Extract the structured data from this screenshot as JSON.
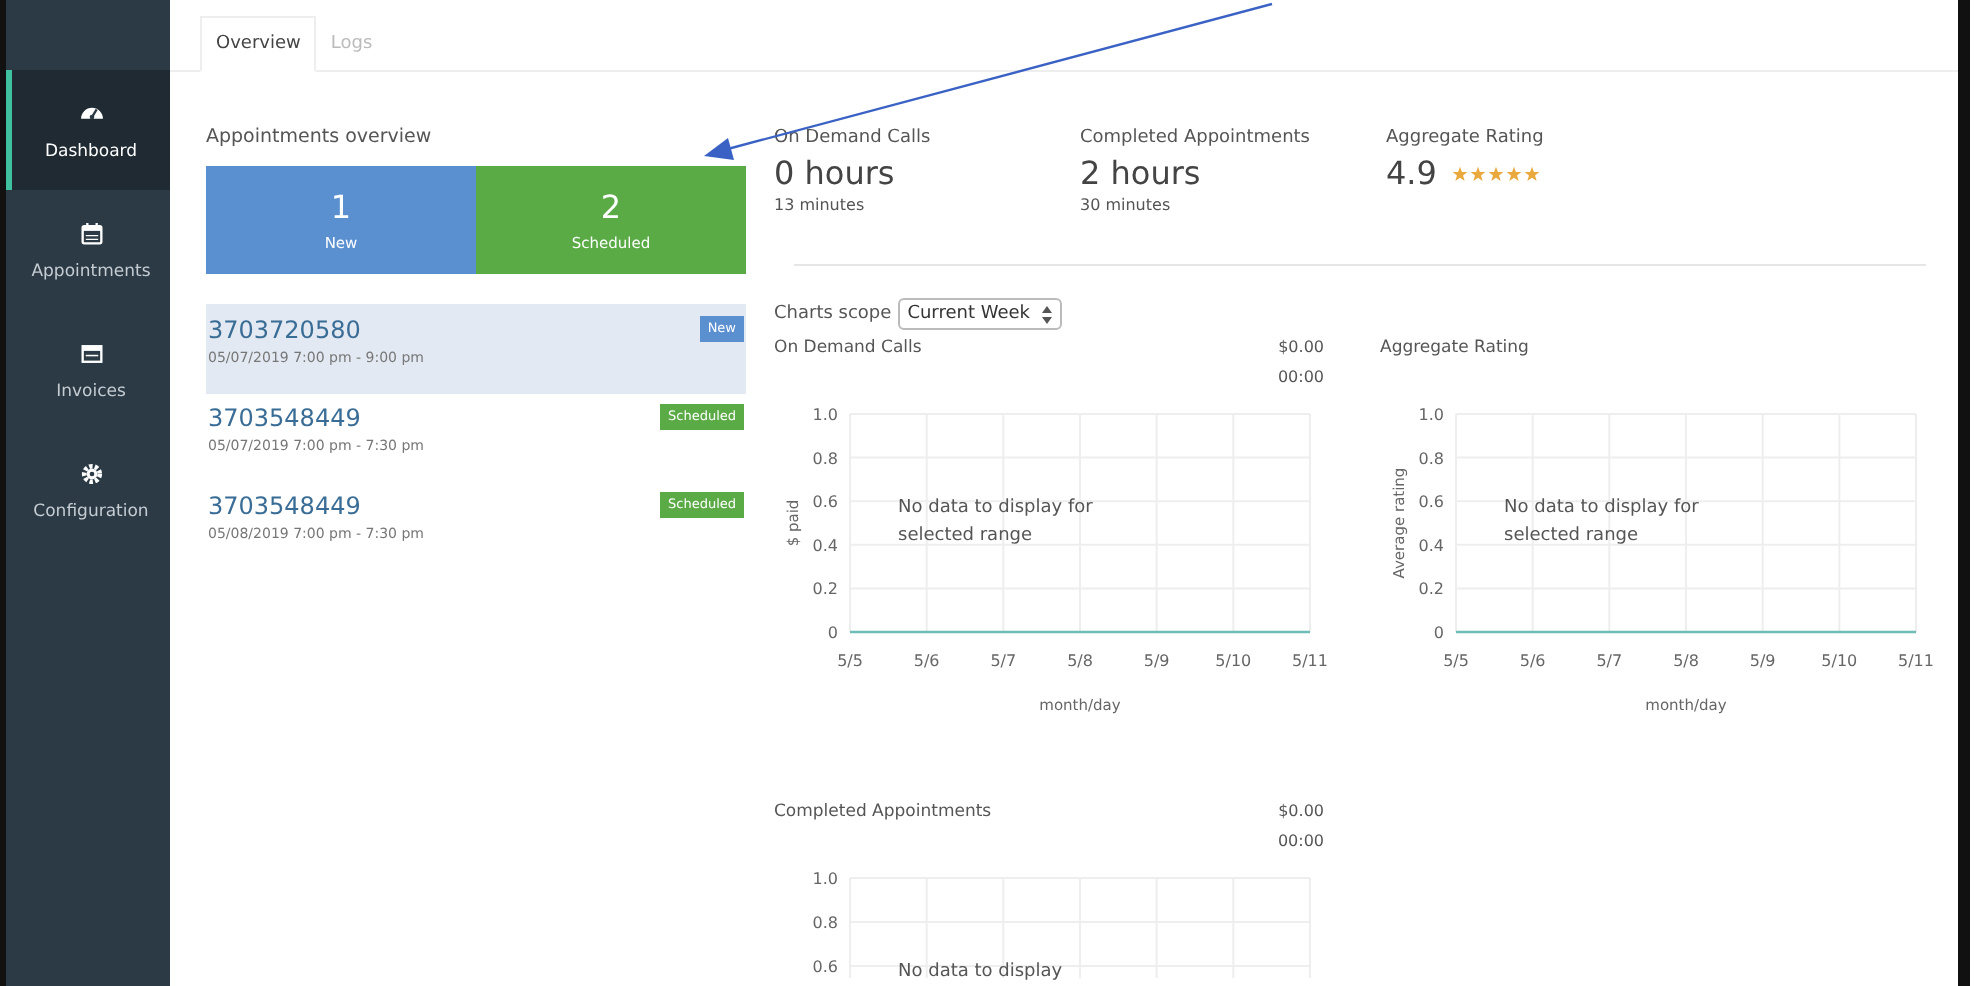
{
  "sidebar": {
    "items": [
      {
        "label": "Dashboard",
        "selected": true
      },
      {
        "label": "Appointments",
        "selected": false
      },
      {
        "label": "Invoices",
        "selected": false
      },
      {
        "label": "Configuration",
        "selected": false
      }
    ]
  },
  "tabs": [
    {
      "label": "Overview",
      "selected": true
    },
    {
      "label": "Logs",
      "selected": false
    }
  ],
  "appointments_overview": {
    "title": "Appointments overview",
    "tiles": [
      {
        "count": "1",
        "label": "New",
        "kind": "new"
      },
      {
        "count": "2",
        "label": "Scheduled",
        "kind": "scheduled"
      }
    ],
    "appointments": [
      {
        "number": "3703720580",
        "time": "05/07/2019 7:00 pm - 9:00 pm",
        "badge": "New",
        "kind": "new",
        "selected": true
      },
      {
        "number": "3703548449",
        "time": "05/07/2019 7:00 pm - 7:30 pm",
        "badge": "Scheduled",
        "kind": "scheduled",
        "selected": false
      },
      {
        "number": "3703548449",
        "time": "05/08/2019 7:00 pm - 7:30 pm",
        "badge": "Scheduled",
        "kind": "scheduled",
        "selected": false
      }
    ]
  },
  "stats": [
    {
      "label": "On Demand Calls",
      "value": "0 hours",
      "detail": "13 minutes"
    },
    {
      "label": "Completed Appointments",
      "value": "2 hours",
      "detail": "30 minutes"
    },
    {
      "label": "Aggregate Rating",
      "value": "4.9",
      "stars": 5
    }
  ],
  "charts_scope": {
    "label": "Charts scope",
    "value": "Current Week"
  },
  "charts": [
    {
      "title": "On Demand Calls",
      "amount": "$0.00",
      "duration": "00:00",
      "empty_message": "No data to display for selected range",
      "chart_data": {
        "type": "line",
        "xlabel": "month/day",
        "ylabel": "$ paid",
        "categories": [
          "5/5",
          "5/6",
          "5/7",
          "5/8",
          "5/9",
          "5/10",
          "5/11"
        ],
        "series": [
          {
            "color": "#6fbdb8",
            "values": [
              0,
              0,
              0,
              0,
              0,
              0,
              0
            ]
          }
        ],
        "grid": true,
        "ylim": [
          0,
          1
        ],
        "yticks": [
          0,
          0.2,
          0.4,
          0.6,
          0.8,
          {
            "value": 1,
            "label": "1.0"
          }
        ]
      }
    },
    {
      "title": "Aggregate Rating",
      "empty_message": "No data to display for selected range",
      "chart_data": {
        "type": "line",
        "xlabel": "month/day",
        "ylabel": "Average rating",
        "categories": [
          "5/5",
          "5/6",
          "5/7",
          "5/8",
          "5/9",
          "5/10",
          "5/11"
        ],
        "series": [
          {
            "color": "#6fbdb8",
            "values": [
              0,
              0,
              0,
              0,
              0,
              0,
              0
            ]
          }
        ],
        "grid": true,
        "ylim": [
          0,
          1
        ],
        "yticks": [
          0,
          0.2,
          0.4,
          0.6,
          0.8,
          {
            "value": 1,
            "label": "1.0"
          }
        ]
      }
    },
    {
      "title": "Completed Appointments",
      "amount": "$0.00",
      "duration": "00:00",
      "empty_message": "No data to display",
      "y_axis_labels": [
        "1.0",
        "0.8",
        "0.6"
      ]
    }
  ]
}
